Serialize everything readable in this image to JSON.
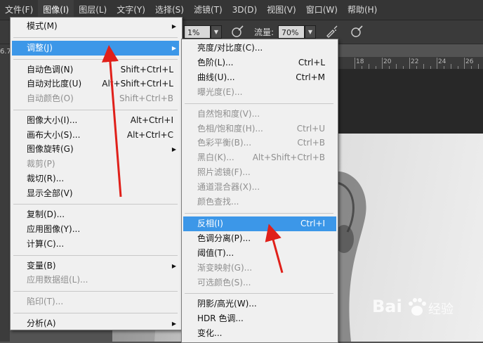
{
  "menubar": {
    "items": [
      {
        "label": "文件(F)"
      },
      {
        "label": "图像(I)"
      },
      {
        "label": "图层(L)"
      },
      {
        "label": "文字(Y)"
      },
      {
        "label": "选择(S)"
      },
      {
        "label": "滤镜(T)"
      },
      {
        "label": "3D(D)"
      },
      {
        "label": "视图(V)"
      },
      {
        "label": "窗口(W)"
      },
      {
        "label": "帮助(H)"
      }
    ],
    "active_index": 1
  },
  "options_bar": {
    "opacity_value": "1%",
    "flow_label": "流量:",
    "flow_value": "70%"
  },
  "zoom_readout": "6.7",
  "ruler": {
    "ticks": [
      "18",
      "20",
      "22",
      "24",
      "26"
    ]
  },
  "image_menu": {
    "sections": [
      [
        {
          "label": "模式(M)",
          "submenu": true,
          "disabled": false
        }
      ],
      [
        {
          "label": "调整(J)",
          "submenu": true,
          "disabled": false,
          "highlight": true
        }
      ],
      [
        {
          "label": "自动色调(N)",
          "shortcut": "Shift+Ctrl+L",
          "disabled": false
        },
        {
          "label": "自动对比度(U)",
          "shortcut": "Alt+Shift+Ctrl+L",
          "disabled": false
        },
        {
          "label": "自动颜色(O)",
          "shortcut": "Shift+Ctrl+B",
          "disabled": true
        }
      ],
      [
        {
          "label": "图像大小(I)...",
          "shortcut": "Alt+Ctrl+I",
          "disabled": false
        },
        {
          "label": "画布大小(S)...",
          "shortcut": "Alt+Ctrl+C",
          "disabled": false
        },
        {
          "label": "图像旋转(G)",
          "submenu": true,
          "disabled": false
        },
        {
          "label": "裁剪(P)",
          "disabled": true
        },
        {
          "label": "裁切(R)...",
          "disabled": false
        },
        {
          "label": "显示全部(V)",
          "disabled": false
        }
      ],
      [
        {
          "label": "复制(D)...",
          "disabled": false
        },
        {
          "label": "应用图像(Y)...",
          "disabled": false
        },
        {
          "label": "计算(C)...",
          "disabled": false
        }
      ],
      [
        {
          "label": "变量(B)",
          "submenu": true,
          "disabled": false
        },
        {
          "label": "应用数据组(L)...",
          "disabled": true
        }
      ],
      [
        {
          "label": "陷印(T)...",
          "disabled": true
        }
      ],
      [
        {
          "label": "分析(A)",
          "submenu": true,
          "disabled": false
        }
      ]
    ]
  },
  "adjust_menu": {
    "sections": [
      [
        {
          "label": "亮度/对比度(C)...",
          "disabled": false
        },
        {
          "label": "色阶(L)...",
          "shortcut": "Ctrl+L",
          "disabled": false
        },
        {
          "label": "曲线(U)...",
          "shortcut": "Ctrl+M",
          "disabled": false
        },
        {
          "label": "曝光度(E)...",
          "disabled": true
        }
      ],
      [
        {
          "label": "自然饱和度(V)...",
          "disabled": true
        },
        {
          "label": "色相/饱和度(H)...",
          "shortcut": "Ctrl+U",
          "disabled": true
        },
        {
          "label": "色彩平衡(B)...",
          "shortcut": "Ctrl+B",
          "disabled": true
        },
        {
          "label": "黑白(K)...",
          "shortcut": "Alt+Shift+Ctrl+B",
          "disabled": true
        },
        {
          "label": "照片滤镜(F)...",
          "disabled": true
        },
        {
          "label": "通道混合器(X)...",
          "disabled": true
        },
        {
          "label": "颜色查找...",
          "disabled": true
        }
      ],
      [
        {
          "label": "反相(I)",
          "shortcut": "Ctrl+I",
          "disabled": false,
          "highlight": true
        },
        {
          "label": "色调分离(P)...",
          "disabled": false
        },
        {
          "label": "阈值(T)...",
          "disabled": false
        },
        {
          "label": "渐变映射(G)...",
          "disabled": true
        },
        {
          "label": "可选颜色(S)...",
          "disabled": true
        }
      ],
      [
        {
          "label": "阴影/高光(W)...",
          "disabled": false
        },
        {
          "label": "HDR 色调...",
          "disabled": false
        },
        {
          "label": "变化...",
          "disabled": false
        }
      ]
    ]
  },
  "watermark": {
    "text": "Bai",
    "suffix": "经验",
    "color": "#ffffff"
  },
  "colors": {
    "highlight": "#3c97e8",
    "annotation_arrow": "#e0201a",
    "menu_bg": "#f0f0f0",
    "disabled_text": "#8f8f8f"
  }
}
